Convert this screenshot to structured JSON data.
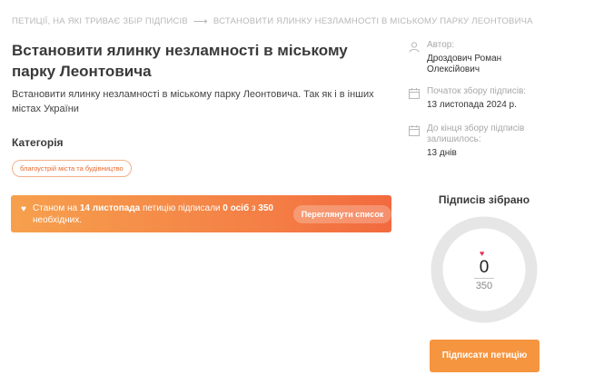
{
  "breadcrumb": {
    "parent": "ПЕТИЦІЇ, НА ЯКІ ТРИВАЄ ЗБІР ПІДПИСІВ",
    "current": "ВСТАНОВИТИ ЯЛИНКУ НЕЗЛАМНОСТІ В МІСЬКОМУ ПАРКУ ЛЕОНТОВИЧА"
  },
  "petition": {
    "title": "Встановити ялинку незламності в міському парку Леонтовича",
    "description": "Встановити ялинку незламності в міському парку Леонтовича. Так як і в інших містах України",
    "category_label": "Категорія",
    "category_tag": "благоустрій міста та будівництво"
  },
  "banner": {
    "prefix": "Станом на",
    "date": "14 листопада",
    "middle": "петицію підписали",
    "signed": "0 осіб",
    "of": "з",
    "needed": "350",
    "suffix": "необхідних.",
    "button_label": "Переглянути список"
  },
  "sidebar": {
    "author_label": "Автор:",
    "author_value": "Дроздович Роман Олексійович",
    "start_label": "Початок збору підписів:",
    "start_value": "13 листопада 2024 р.",
    "remaining_label": "До кінця збору підписів залишилось:",
    "remaining_value": "13 днів"
  },
  "signatures": {
    "title": "Підписів зібрано",
    "count": "0",
    "total": "350",
    "progress_fraction": 0,
    "ring_color": "#e6e6e6",
    "fill_color": "#f6953f",
    "sign_button_label": "Підписати петицію"
  },
  "colors": {
    "accent": "#f6953f",
    "banner_start": "#f6a04d",
    "banner_end": "#f26a3e",
    "heart": "#e8325a"
  }
}
